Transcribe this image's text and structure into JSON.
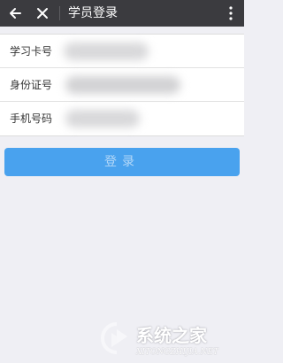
{
  "header": {
    "title": "学员登录",
    "bg_color": "#3b3b3f",
    "icons": [
      "back-arrow-icon",
      "close-icon",
      "more-vertical-icon"
    ]
  },
  "form": {
    "rows": [
      {
        "label": "学习卡号",
        "value": ""
      },
      {
        "label": "身份证号",
        "value": ""
      },
      {
        "label": "手机号码",
        "value": ""
      }
    ]
  },
  "login_button": {
    "label": "登录",
    "color": "#49a2ee"
  },
  "watermark": {
    "brand": "系统之家",
    "sub": "XITONGZHIJIA.NET"
  }
}
